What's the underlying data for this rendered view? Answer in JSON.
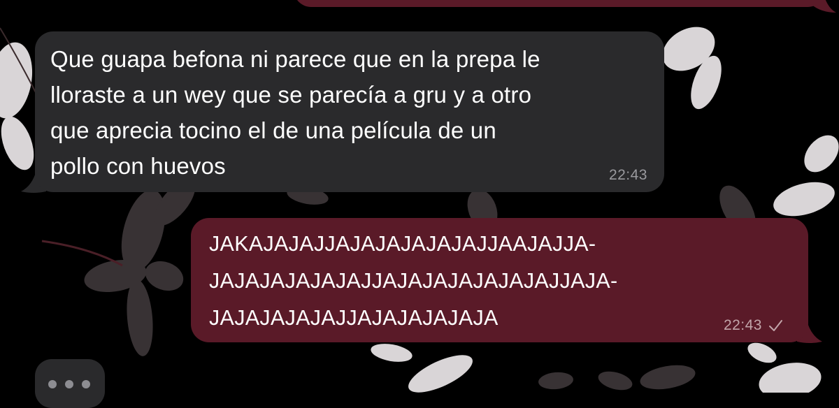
{
  "messages": {
    "incoming": {
      "lines": [
        "Que guapa befona ni parece que en la prepa le",
        "lloraste a un wey que se parecía a gru y a otro",
        "que aprecia tocino el de una película de un",
        "pollo con huevos"
      ],
      "time": "22:43"
    },
    "outgoing": {
      "lines": [
        "JAKAJAJAJJAJAJAJAJAJAJJAAJAJJA-",
        "JAJAJAJAJAJAJJAJAJAJAJAJAJAJJAJA-",
        "JAJAJAJAJAJJAJAJAJAJAJA"
      ],
      "time": "22:43",
      "status_icon": "checkmark-icon"
    }
  },
  "typing_indicator": {
    "icon": "typing-dots-icon"
  },
  "colors": {
    "background": "#000000",
    "incoming_bubble": "#2a2a2c",
    "outgoing_bubble": "#5a1a28",
    "text": "#ffffff",
    "timestamp": "#9a9a9e"
  }
}
